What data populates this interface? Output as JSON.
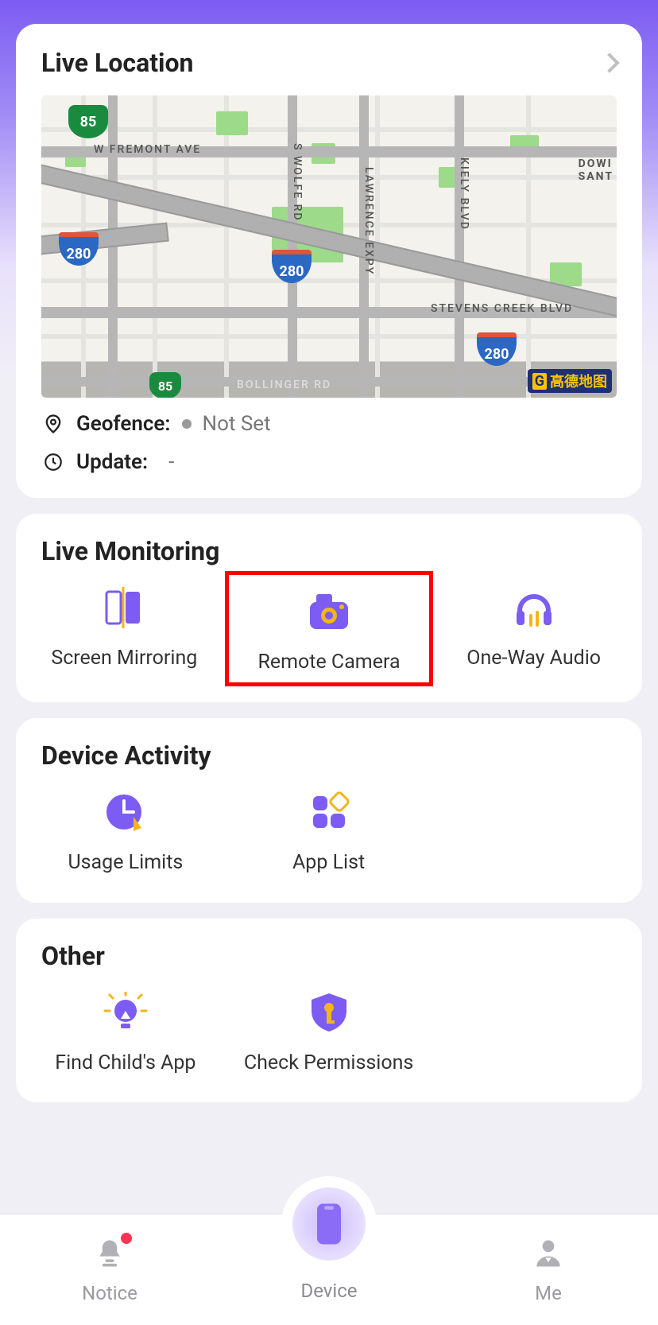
{
  "liveLocation": {
    "title": "Live Location",
    "geofenceLabel": "Geofence:",
    "geofenceValue": "Not Set",
    "updateLabel": "Update:",
    "updateValue": "-",
    "map": {
      "shields": {
        "green": "85",
        "blueA": "280",
        "blueB": "280",
        "blueC": "280"
      },
      "labels": {
        "fremont": "W FREMONT AVE",
        "swolfe": "S WOLFE RD",
        "lawrence": "LAWRENCE EXPY",
        "kiely": "KIELY BLVD",
        "stevens": "STEVENS CREEK BLVD",
        "bollinger": "BOLLINGER RD",
        "downtown": "DOWI\nSANT"
      },
      "attribution": "高德地图"
    }
  },
  "liveMonitoring": {
    "title": "Live Monitoring",
    "items": [
      {
        "label": "Screen Mirroring"
      },
      {
        "label": "Remote Camera"
      },
      {
        "label": "One-Way Audio"
      }
    ]
  },
  "deviceActivity": {
    "title": "Device Activity",
    "items": [
      {
        "label": "Usage Limits"
      },
      {
        "label": "App List"
      }
    ]
  },
  "other": {
    "title": "Other",
    "items": [
      {
        "label": "Find Child's App"
      },
      {
        "label": "Check Permissions"
      }
    ]
  },
  "tabs": {
    "notice": "Notice",
    "device": "Device",
    "me": "Me"
  }
}
